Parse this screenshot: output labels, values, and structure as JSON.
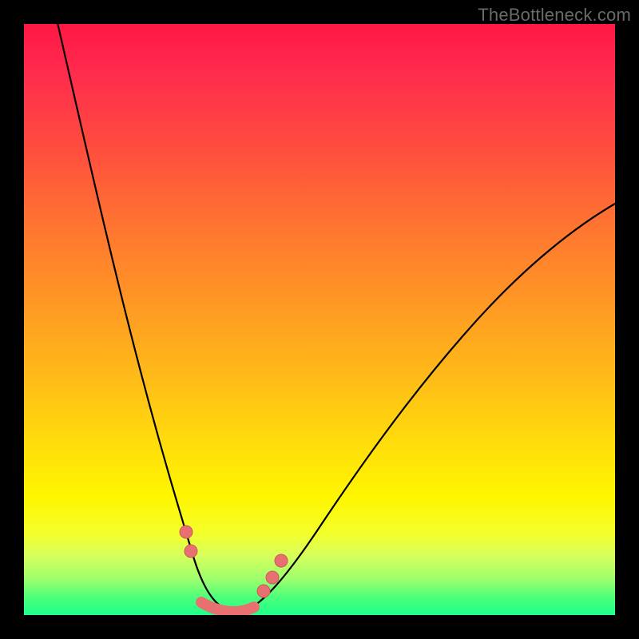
{
  "watermark": "TheBottleneck.com",
  "colors": {
    "background": "#000000",
    "curve": "#000000",
    "marker": "#e97070",
    "gradient_top": "#ff1744",
    "gradient_bottom": "#1eff8c"
  },
  "chart_data": {
    "type": "line",
    "title": "",
    "xlabel": "",
    "ylabel": "",
    "xlim": [
      0,
      100
    ],
    "ylim": [
      0,
      100
    ],
    "note": "No axes, ticks, or labels are rendered. Values are relative percentages of the plot area (0=left/bottom, 100=right/top). Curve is a V-shaped bottleneck profile with minimum near x≈33.",
    "series": [
      {
        "name": "bottleneck-curve",
        "x": [
          5,
          8,
          12,
          16,
          20,
          23,
          25,
          27,
          29,
          31,
          33,
          35,
          38,
          42,
          48,
          55,
          63,
          72,
          82,
          92,
          100
        ],
        "y": [
          100,
          88,
          72,
          56,
          40,
          28,
          20,
          13,
          7,
          3,
          1,
          1,
          3,
          7,
          14,
          24,
          36,
          48,
          58,
          65,
          70
        ]
      }
    ],
    "markers": {
      "comment": "Salmon-colored dots/segments near the trough of the curve",
      "points": [
        {
          "x": 25.5,
          "y": 18
        },
        {
          "x": 26.5,
          "y": 14
        },
        {
          "x": 38.5,
          "y": 9
        },
        {
          "x": 40.0,
          "y": 12
        },
        {
          "x": 41.5,
          "y": 15
        }
      ],
      "trough_band": {
        "x_start": 29,
        "x_end": 37,
        "y": 1.5
      }
    }
  }
}
